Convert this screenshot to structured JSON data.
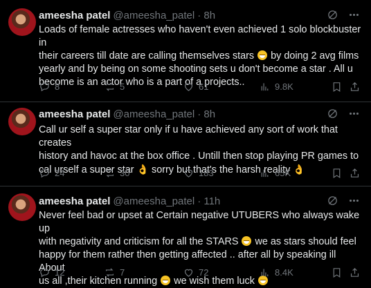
{
  "tweets": [
    {
      "name": "ameesha patel",
      "handle": "@ameesha_patel",
      "time": "· 8h",
      "lines": [
        "Loads of female actresses who haven't even achieved 1 solo  blockbuster in",
        "their careers till date are calling themselves stars",
        "by doing 2 avg films",
        "yearly and by being on some shooting sets u don't become a star . All u",
        "become is an actor who is a part of a projects.."
      ],
      "replies": "8",
      "reposts": "5",
      "likes": "61",
      "views": "9.8K"
    },
    {
      "name": "ameesha patel",
      "handle": "@ameesha_patel",
      "time": "· 8h",
      "lines": [
        "Call ur self a super star only if u have achieved any sort of work that creates",
        "history and havoc  at the box office . Untill then stop playing PR games to",
        "cal urself a super star",
        "sorry but that's the harsh reality"
      ],
      "replies": "24",
      "reposts": "30",
      "likes": "183",
      "views": "65K"
    },
    {
      "name": "ameesha patel",
      "handle": "@ameesha_patel",
      "time": "· 11h",
      "lines": [
        "Never feel  bad or upset at  Certain negative UTUBERS who always wake up",
        "with negativity and criticism for all the STARS",
        "we as stars should feel",
        "happy for them rather then getting affected .. after all by speaking ill About",
        "us all ,their kitchen   running",
        "we wish them luck"
      ],
      "replies": "12",
      "reposts": "7",
      "likes": "72",
      "views": "8.4K"
    }
  ],
  "icons": [
    "grok-icon",
    "more-icon",
    "reply-icon",
    "repost-icon",
    "like-icon",
    "views-icon",
    "bookmark-icon",
    "share-icon",
    "grinning-emoji",
    "ok-hand-emoji"
  ]
}
